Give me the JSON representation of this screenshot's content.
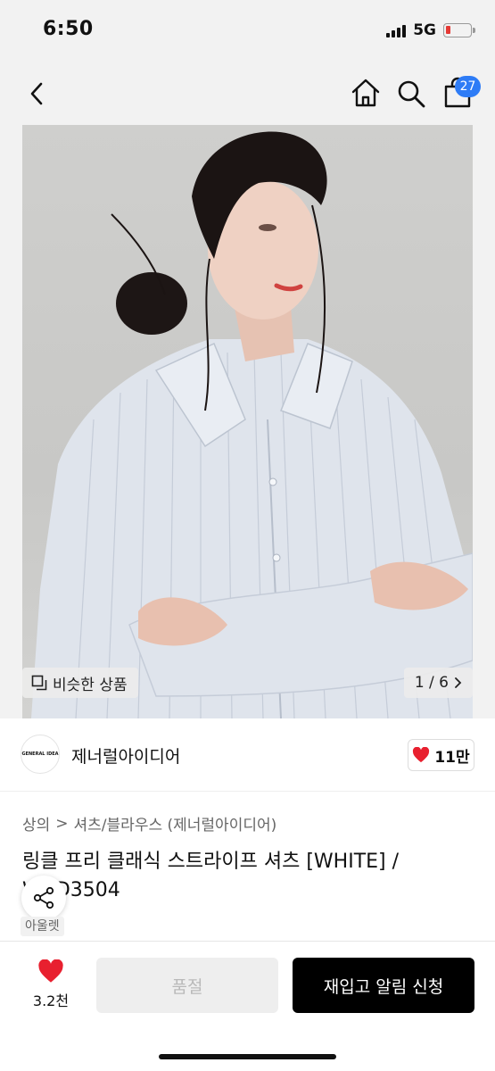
{
  "status_bar": {
    "time": "6:50",
    "network": "5G",
    "battery_level": 0.15,
    "battery_color": "#e53935"
  },
  "header": {
    "back_icon": "chevron-left-icon",
    "home_icon": "home-icon",
    "search_icon": "search-icon",
    "cart_icon": "shopping-bag-icon",
    "cart_count": "27",
    "badge_color": "#2e7cf6"
  },
  "gallery": {
    "similar_label": "비슷한 상품",
    "similar_icon": "copy-icon",
    "page_indicator": "1 / 6",
    "page_chevron": "chevron-right-icon"
  },
  "brand": {
    "logo_text": "GENERAL IDEA",
    "name": "제너럴아이디어",
    "like_count": "11만",
    "like_icon": "heart-icon"
  },
  "product": {
    "breadcrumb": [
      "상의",
      "셔츠/블라우스 (제너럴아이디어)"
    ],
    "breadcrumb_separator": ">",
    "title": "링클 프리 클래식 스트라이프 셔츠 [WHITE] / WBD3504",
    "title_visible_suffix": "03504",
    "outlet_tag": "아울렛",
    "share_icon": "share-icon"
  },
  "bottom_bar": {
    "like_count": "3.2천",
    "like_icon": "heart-icon",
    "soldout_label": "품절",
    "restock_label": "재입고 알림 신청",
    "heart_color": "#e8202f"
  }
}
